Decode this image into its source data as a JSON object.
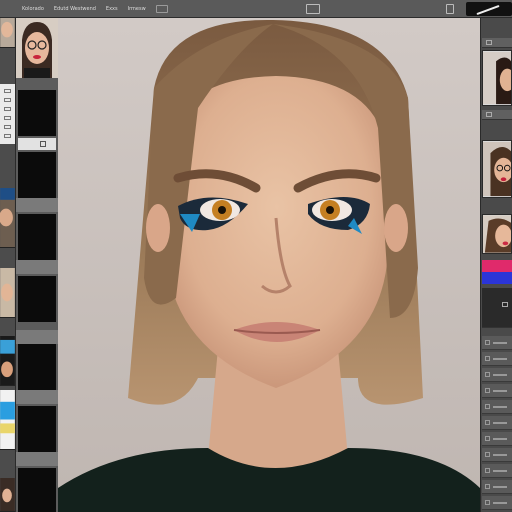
{
  "menubar": {
    "items": [
      "Kolorado",
      "Edutd Westwend",
      "Exxs",
      "Irmesw"
    ]
  },
  "left_toolstrip": {
    "tools": [
      "marquee-tool",
      "lasso-tool",
      "crop-tool",
      "eyedropper-tool",
      "brush-tool",
      "text-tool"
    ]
  },
  "canvas": {
    "subject": "portrait"
  },
  "right_panel": {
    "swatches": [
      "#e02a6b",
      "#2b35d8"
    ]
  },
  "colors": {
    "ui_dark": "#454545",
    "ui_mid": "#5a5a5a",
    "canvas_bg": "#c9c1bd"
  }
}
